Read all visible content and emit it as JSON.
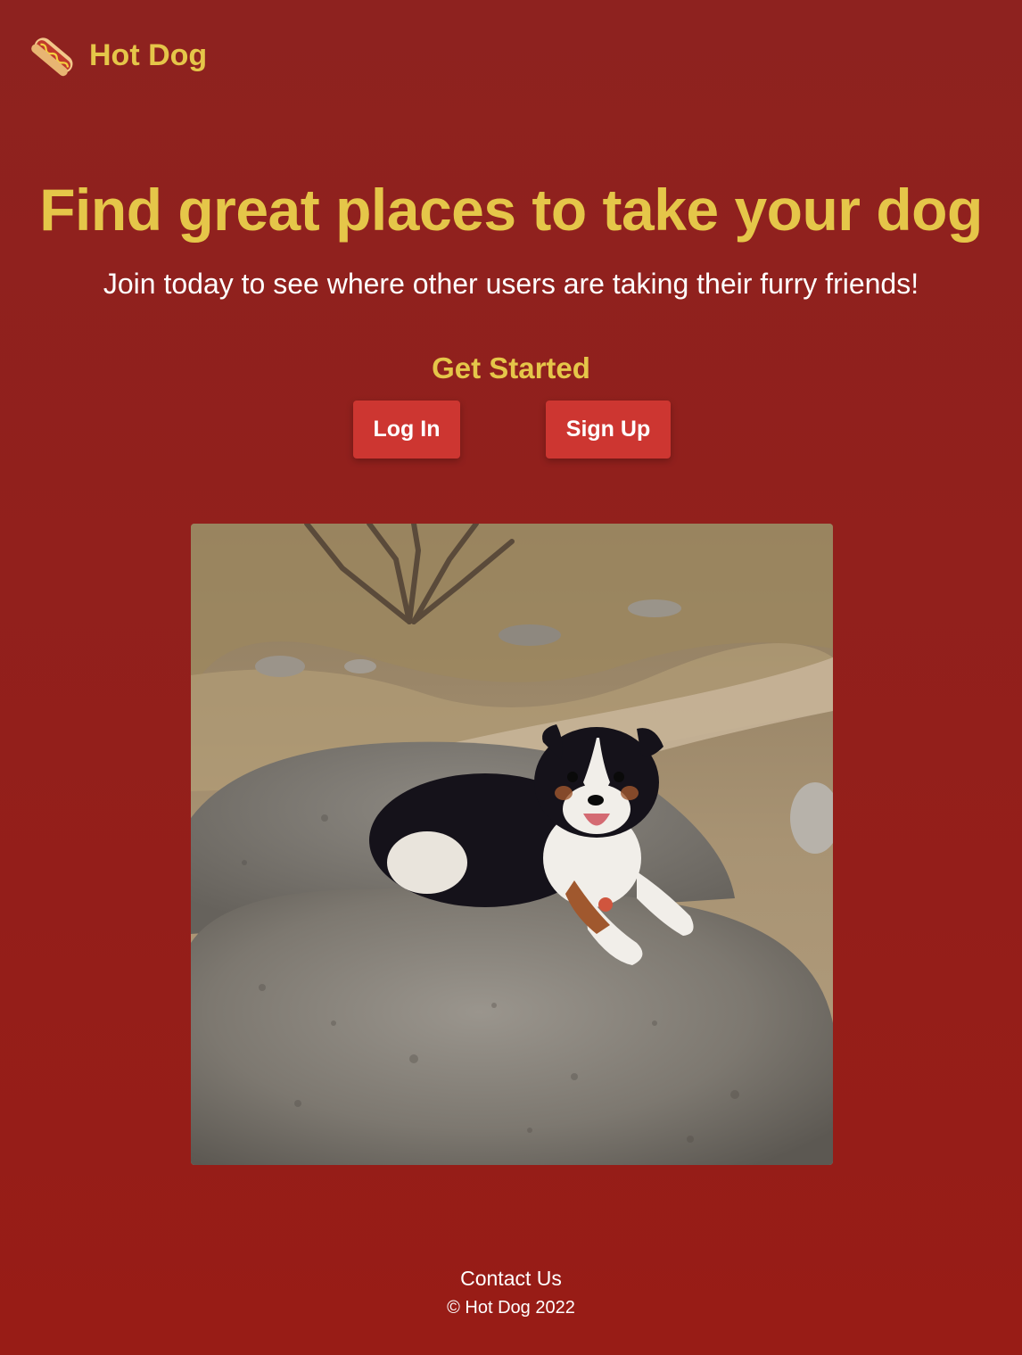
{
  "brand": {
    "name": "Hot Dog",
    "icon": "hot-dog-icon"
  },
  "hero": {
    "title": "Find great places to take your dog",
    "subtitle": "Join today to see where other users are taking their furry friends!"
  },
  "cta": {
    "heading": "Get Started",
    "login_label": "Log In",
    "signup_label": "Sign Up"
  },
  "photo": {
    "subject": "dog-on-rock-photo"
  },
  "footer": {
    "contact_label": "Contact Us",
    "copyright": "© Hot Dog 2022"
  },
  "colors": {
    "background": "#921f1b",
    "accent_yellow": "#e5c649",
    "button_red": "#cd3631",
    "text_white": "#ffffff"
  }
}
